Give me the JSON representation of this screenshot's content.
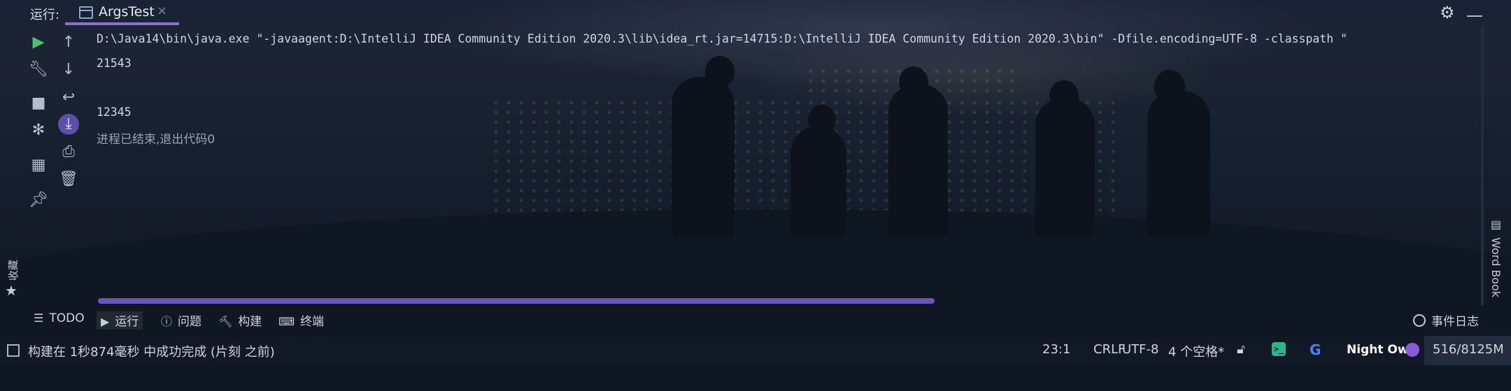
{
  "topbar": {
    "run_label": "运行:",
    "tab_label": "ArgsTest",
    "close_glyph": "×"
  },
  "console": {
    "lines": [
      "D:\\Java14\\bin\\java.exe \"-javaagent:D:\\IntelliJ IDEA Community Edition 2020.3\\lib\\idea_rt.jar=14715:D:\\IntelliJ IDEA Community Edition 2020.3\\bin\" -Dfile.encoding=UTF-8 -classpath \"",
      "21543",
      "12345",
      "进程已结束,退出代码0"
    ]
  },
  "left_tools": {
    "col1": [
      "run-icon",
      "wrench-icon",
      "stop-icon",
      "debug-gear-icon",
      "layout-icon",
      "pin-icon"
    ],
    "col2": [
      "arrow-up-icon",
      "arrow-down-icon",
      "soft-wrap-icon",
      "scroll-to-end-icon",
      "print-icon",
      "trash-icon"
    ]
  },
  "sidebar_right": {
    "wordbook": "Word Book"
  },
  "sidebar_left": {
    "favorites": "收藏"
  },
  "tool_windows": {
    "todo": "TODO",
    "run": "运行",
    "problems": "问题",
    "build": "构建",
    "terminal": "终端",
    "event_log": "事件日志"
  },
  "status": {
    "message": "构建在 1秒874毫秒 中成功完成 (片刻 之前)",
    "position": "23:1",
    "line_sep": "CRLF",
    "encoding": "UTF-8",
    "indent": "4 个空格*",
    "theme": "Night Owl",
    "memory": "516/8125M"
  },
  "colors": {
    "accent": "#8a6fd0",
    "run_green": "#49c46b",
    "scrollbar": "#6a55b8"
  }
}
